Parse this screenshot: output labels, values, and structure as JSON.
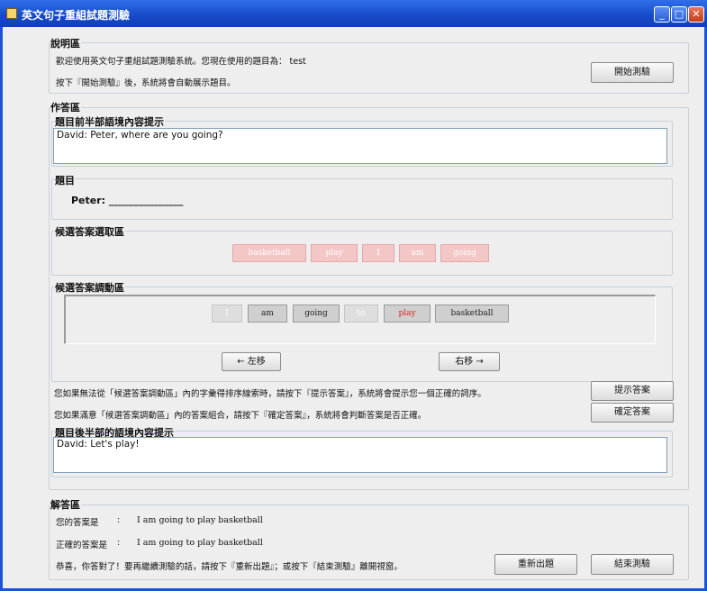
{
  "window": {
    "title": "英文句子重組試題測驗"
  },
  "intro": {
    "heading": "說明區",
    "welcome": "歡迎使用英文句子重組試題測驗系統。您現在使用的題目為： test",
    "instruction": "按下『開始測驗』後，系統將會自動展示題目。",
    "start_label": "開始測驗"
  },
  "answer_area": {
    "heading": "作答區",
    "prefix_hint": {
      "heading": "題目前半部語境內容提示",
      "text": "David: Peter, where are you going?"
    },
    "question": {
      "heading": "題目",
      "speaker": "Peter: _______________"
    },
    "candidates": {
      "heading": "候選答案選取區",
      "tiles": [
        "basketball",
        "play",
        "I",
        "am",
        "going"
      ]
    },
    "arrange": {
      "heading": "候選答案調動區",
      "tiles": [
        "I",
        "am",
        "going",
        "to",
        "play",
        "basketball"
      ],
      "left_label": "← 左移",
      "right_label": "右移 →"
    },
    "hint_instruction": "您如果無法從「候選答案調動區」內的字彙得排序線索時，請按下『提示答案』，系統將會提示您一個正確的詞序。",
    "hint_label": "提示答案",
    "confirm_instruction": "您如果滿意「候選答案調動區」內的答案組合，請按下『確定答案』，系統將會判斷答案是否正確。",
    "confirm_label": "確定答案",
    "suffix_hint": {
      "heading": "題目後半部的語境內容提示",
      "text": "David: Let's play!"
    }
  },
  "solution": {
    "heading": "解答區",
    "your_answer_label": "您的答案是",
    "your_answer": "I am going to play basketball",
    "correct_answer_label": "正確的答案是",
    "correct_answer": "I am going to play basketball",
    "colon": ":",
    "message": "恭喜，你答對了！要再繼續測驗的話，請按下『重新出題』；或按下『結束測驗』離開視窗。",
    "new_question_label": "重新出題",
    "end_label": "結束測驗"
  }
}
